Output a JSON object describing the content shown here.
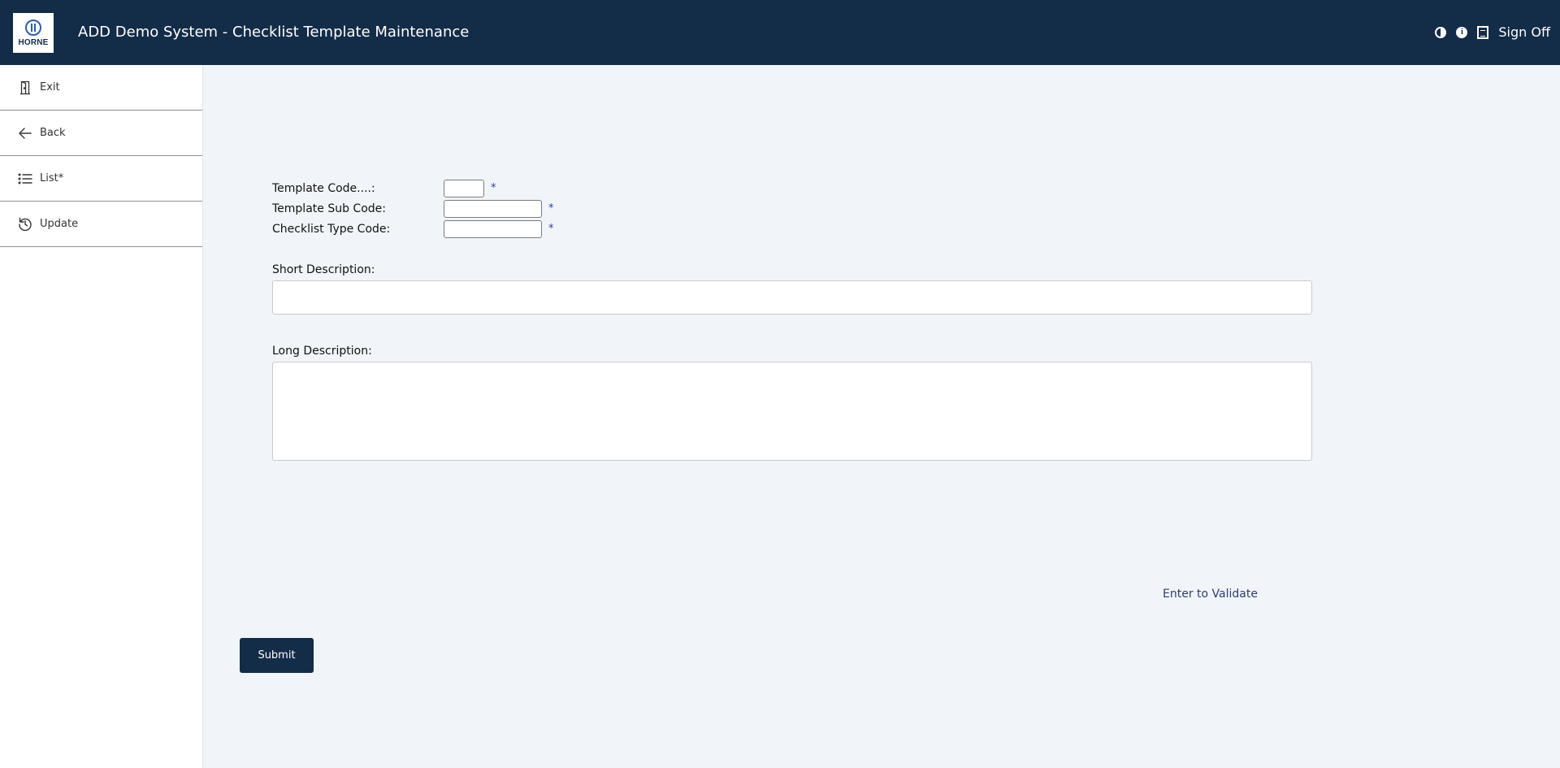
{
  "header": {
    "logo_text": "HORNE",
    "title": "ADD Demo System - Checklist Template Maintenance",
    "icons": [
      "contrast-icon",
      "info-icon",
      "document-icon"
    ],
    "sign_off_label": "Sign Off"
  },
  "sidebar": {
    "items": [
      {
        "label": "Exit",
        "icon": "door-icon"
      },
      {
        "label": "Back",
        "icon": "arrow-left-icon"
      },
      {
        "label": "List*",
        "icon": "list-icon"
      },
      {
        "label": "Update",
        "icon": "refresh-icon"
      }
    ]
  },
  "form": {
    "template_code_label": "Template Code....:",
    "template_code_value": "",
    "template_sub_code_label": "Template Sub Code:",
    "template_sub_code_value": "",
    "checklist_type_code_label": "Checklist Type Code:",
    "checklist_type_code_value": "",
    "required_marker": "*",
    "short_description_label": "Short Description:",
    "short_description_value": "",
    "long_description_label": "Long Description:",
    "long_description_value": "",
    "validate_hint": "Enter to Validate",
    "submit_label": "Submit"
  },
  "colors": {
    "header_bg": "#132c48",
    "page_bg": "#f1f5f9",
    "required_marker": "#2a3f8f",
    "button_bg": "#132c48"
  }
}
